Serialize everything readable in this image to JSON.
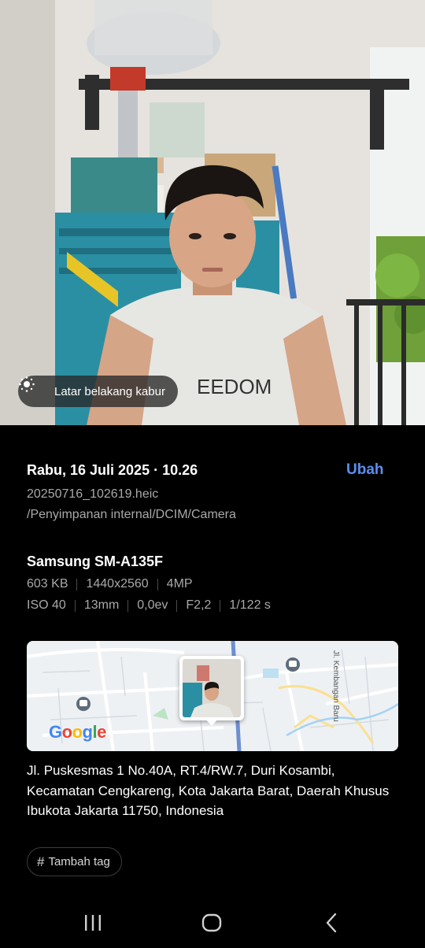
{
  "photo": {
    "blur_label": "Latar belakang kabur",
    "blur_icon": "background-blur-icon"
  },
  "details": {
    "datetime": "Rabu, 16 Juli 2025 · 10.26",
    "edit_label": "Ubah",
    "filename": "20250716_102619.heic",
    "path": "/Penyimpanan internal/DCIM/Camera",
    "device": "Samsung SM-A135F",
    "specs_row1": [
      "603 KB",
      "1440x2560",
      "4MP"
    ],
    "specs_row2": [
      "ISO 40",
      "13mm",
      "0,0ev",
      "F2,2",
      "1/122 s"
    ]
  },
  "map": {
    "street_label": "Jl. Kembangan Baru",
    "provider": "Google",
    "accent": "#5b8ff0"
  },
  "address": "Jl. Puskesmas 1 No.40A, RT.4/RW.7, Duri Kosambi, Kecamatan Cengkareng, Kota Jakarta Barat, Daerah Khusus Ibukota Jakarta 11750, Indonesia",
  "tag": {
    "icon": "hash-icon",
    "label": "Tambah tag"
  },
  "navbar": {
    "recents_icon": "recents-icon",
    "home_icon": "home-icon",
    "back_icon": "back-icon"
  }
}
